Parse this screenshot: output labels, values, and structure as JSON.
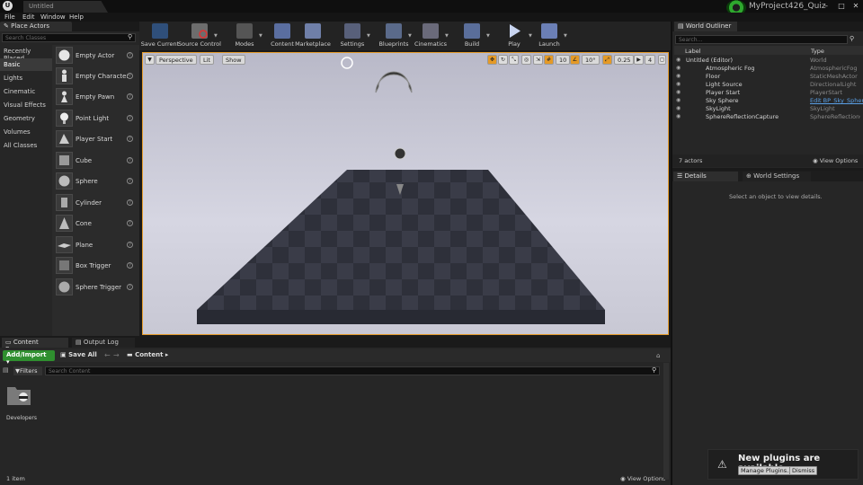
{
  "title_bar": {
    "document_tab": "Untitled",
    "project_name": "MyProject426_Quiz",
    "window_controls": [
      "minimize-icon",
      "maximize-icon",
      "close-icon"
    ]
  },
  "menu": [
    "File",
    "Edit",
    "Window",
    "Help"
  ],
  "place_actors": {
    "tab_label": "Place Actors",
    "search_placeholder": "Search Classes",
    "categories": [
      "Recently Placed",
      "Basic",
      "Lights",
      "Cinematic",
      "Visual Effects",
      "Geometry",
      "Volumes",
      "All Classes"
    ],
    "active_category": "Basic",
    "items": [
      "Empty Actor",
      "Empty Character",
      "Empty Pawn",
      "Point Light",
      "Player Start",
      "Cube",
      "Sphere",
      "Cylinder",
      "Cone",
      "Plane",
      "Box Trigger",
      "Sphere Trigger"
    ]
  },
  "toolbar": {
    "buttons": [
      "Save Current",
      "Source Control",
      "Modes",
      "Content",
      "Marketplace",
      "Settings",
      "Blueprints",
      "Cinematics",
      "Build",
      "Play",
      "Launch"
    ]
  },
  "viewport": {
    "perspective_label": "Perspective",
    "lit_label": "Lit",
    "show_label": "Show",
    "grid_snap": "10",
    "rotation_snap": "10°",
    "scale_snap": "0.25",
    "camera_speed": "4"
  },
  "world_outliner": {
    "tab_label": "World Outliner",
    "search_placeholder": "Search...",
    "col_label": "Label",
    "col_type": "Type",
    "rows": [
      {
        "label": "Untitled (Editor)",
        "type": "World"
      },
      {
        "label": "Atmospheric Fog",
        "type": "AtmosphericFog"
      },
      {
        "label": "Floor",
        "type": "StaticMeshActor"
      },
      {
        "label": "Light Source",
        "type": "DirectionalLight"
      },
      {
        "label": "Player Start",
        "type": "PlayerStart"
      },
      {
        "label": "Sky Sphere",
        "type": "Edit BP_Sky_Sphere"
      },
      {
        "label": "SkyLight",
        "type": "SkyLight"
      },
      {
        "label": "SphereReflectionCapture",
        "type": "SphereReflectionCap"
      }
    ],
    "actor_count": "7 actors",
    "view_options": "View Options"
  },
  "details": {
    "tab_details": "Details",
    "tab_world_settings": "World Settings",
    "empty_message": "Select an object to view details."
  },
  "content_browser": {
    "tab_content_browser": "Content Browser",
    "tab_output_log": "Output Log",
    "add_import": "Add/Import",
    "save_all": "Save All",
    "path": "Content",
    "filters": "Filters",
    "search_placeholder": "Search Content",
    "folders": [
      "Developers"
    ],
    "item_count": "1 item",
    "view_options": "View Options"
  },
  "notification": {
    "message": "New plugins are available",
    "manage_button": "Manage Plugins...",
    "dismiss_button": "Dismiss"
  },
  "colors": {
    "accent_orange": "#e49b2b",
    "add_import_green": "#2f8f2f",
    "link_blue": "#5aa0e6"
  }
}
